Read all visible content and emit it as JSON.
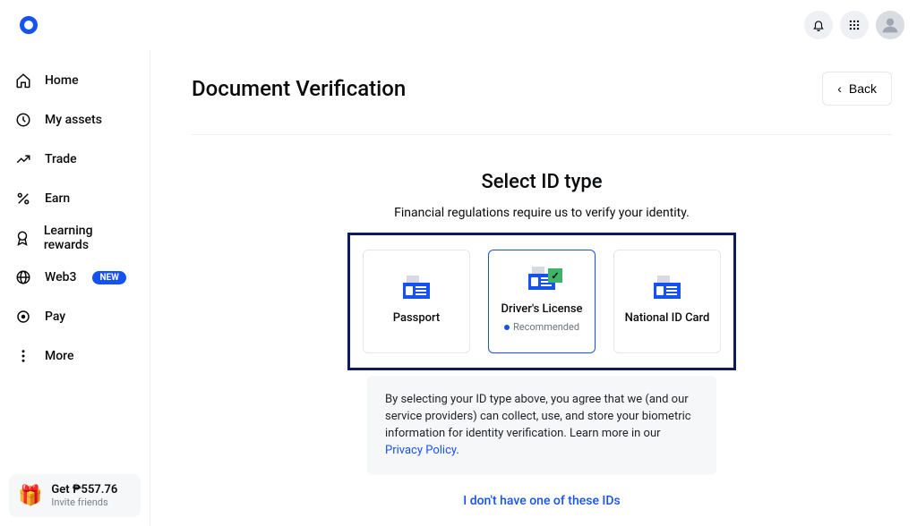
{
  "sidebar": {
    "items": [
      {
        "label": "Home",
        "icon": "home"
      },
      {
        "label": "My assets",
        "icon": "clock"
      },
      {
        "label": "Trade",
        "icon": "trend"
      },
      {
        "label": "Earn",
        "icon": "percent"
      },
      {
        "label": "Learning rewards",
        "icon": "badge"
      },
      {
        "label": "Web3",
        "icon": "globe",
        "badge": "NEW"
      },
      {
        "label": "Pay",
        "icon": "circle"
      },
      {
        "label": "More",
        "icon": "more"
      }
    ]
  },
  "invite": {
    "title": "Get ₱557.76",
    "subtitle": "Invite friends"
  },
  "page": {
    "title": "Document Verification",
    "back_label": "Back"
  },
  "select": {
    "title": "Select ID type",
    "subtitle": "Financial regulations require us to verify your identity."
  },
  "id_options": [
    {
      "label": "Passport",
      "selected": false,
      "recommended": false,
      "check": false
    },
    {
      "label": "Driver's License",
      "selected": true,
      "recommended": true,
      "check": true
    },
    {
      "label": "National ID Card",
      "selected": false,
      "recommended": false,
      "check": false
    }
  ],
  "recommended_label": "Recommended",
  "disclaimer": {
    "pre": "By selecting your ID type above, you agree that we (and our service providers) can collect, use, and store your biometric information for identity verification. Learn more in our ",
    "link": "Privacy Policy",
    "post": "."
  },
  "no_id_link": "I don't have one of these IDs"
}
